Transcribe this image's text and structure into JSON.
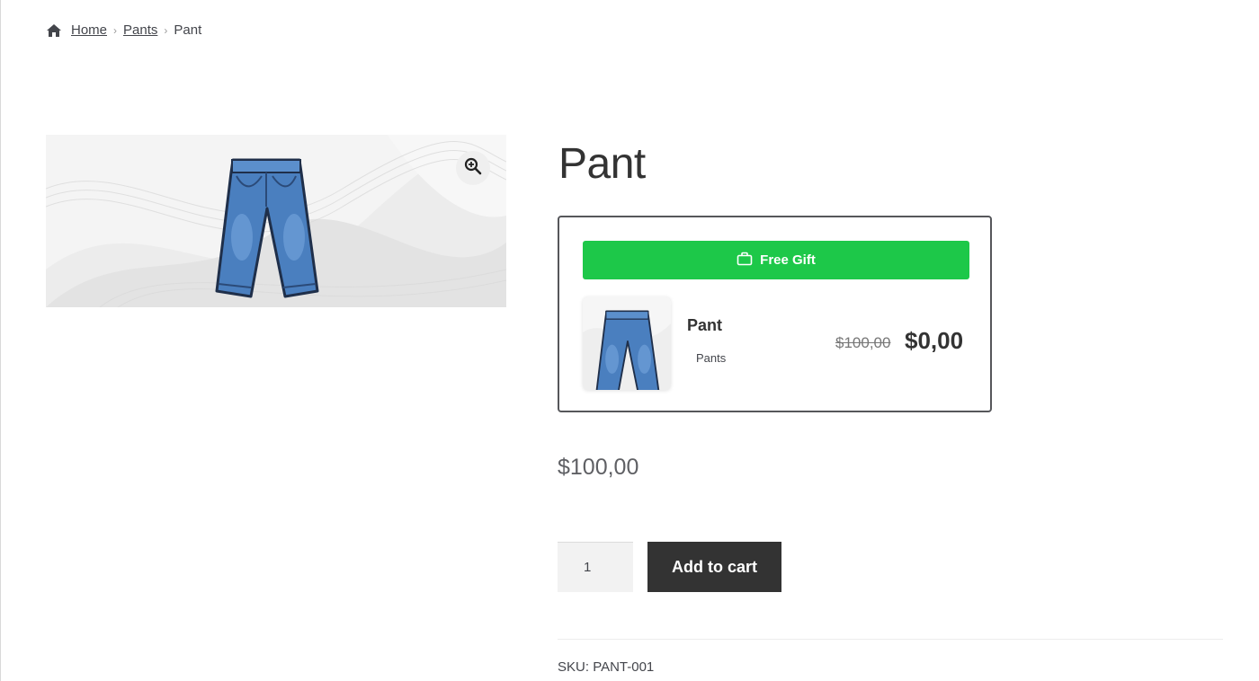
{
  "breadcrumb": {
    "home": "Home",
    "category": "Pants",
    "current": "Pant",
    "separator": "›"
  },
  "gallery": {
    "zoom_icon": "zoom-in-icon"
  },
  "product": {
    "title": "Pant",
    "price": "$100,00",
    "quantity": "1",
    "add_to_cart": "Add to cart",
    "sku_label": "SKU:",
    "sku": "PANT-001"
  },
  "gift": {
    "banner": "Free Gift",
    "banner_icon": "gift-bag-icon",
    "item_name": "Pant",
    "item_category": "Pants",
    "old_price": "$100,00",
    "new_price": "$0,00"
  },
  "colors": {
    "gift_banner": "#1dc849",
    "button_bg": "#333333",
    "denim": "#4a7fbf"
  }
}
